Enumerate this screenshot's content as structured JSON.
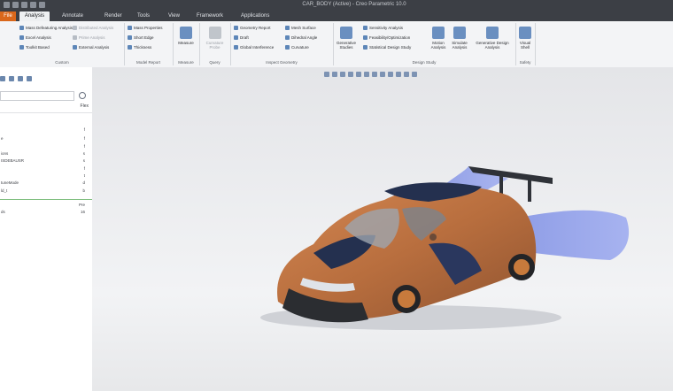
{
  "window": {
    "title": "CAR_BODY (Active) - Creo Parametric 10.0"
  },
  "tabs": [
    {
      "label": "File"
    },
    {
      "label": "Analysis"
    },
    {
      "label": "Annotate"
    },
    {
      "label": "Render"
    },
    {
      "label": "Tools"
    },
    {
      "label": "View"
    },
    {
      "label": "Framework"
    },
    {
      "label": "Applications"
    }
  ],
  "ribbon": {
    "model_report": {
      "items": [
        "Mass Defeaturing Analysis",
        "Excel Analysis",
        "Toolkit Based",
        "Distributed Analysis",
        "Prime Analysis",
        "External Analysis"
      ],
      "label": "Custom"
    },
    "measure_group": {
      "items": [
        "Mass Properties",
        "Short Edge",
        "Thickness"
      ],
      "label": "Model Report"
    },
    "measure": {
      "label": "Measure",
      "group": "Measure"
    },
    "query": {
      "label": "Curvature Probe",
      "group": "Query"
    },
    "inspect": {
      "items": [
        "Geometry Report",
        "Draft",
        "Global Interference",
        "Mesh Surface",
        "Dihedral Angle",
        "Curvature"
      ],
      "label": "Inspect Geometry"
    },
    "design_study": {
      "items": [
        "Sensitivity Analysis",
        "Feasibility/Optimization",
        "Statistical Design Study"
      ],
      "big": [
        "Generative Studies",
        "Motion Analysis",
        "Simulate Analysis",
        "Generative Design Analysis"
      ],
      "label": "Design Study"
    },
    "safety": {
      "label": "Visual Shell",
      "group": "Safety"
    }
  },
  "left_panel": {
    "header_right": "Flex",
    "rows": [
      {
        "name": "",
        "value": "f"
      },
      {
        "name": "e",
        "value": "f"
      },
      {
        "name": "",
        "value": "f"
      },
      {
        "name": "ions",
        "value": "s"
      },
      {
        "name": "ISDEBAUSR",
        "value": "s"
      },
      {
        "name": "",
        "value": "f"
      },
      {
        "name": "",
        "value": "t"
      },
      {
        "name": "tuneMode",
        "value": "d"
      },
      {
        "name": "ld_t",
        "value": "b"
      },
      {
        "name": "",
        "value": "Pre"
      },
      {
        "name": "ds",
        "value": "16"
      }
    ]
  },
  "viewport": {
    "model": "race-car-with-aero-fan"
  }
}
